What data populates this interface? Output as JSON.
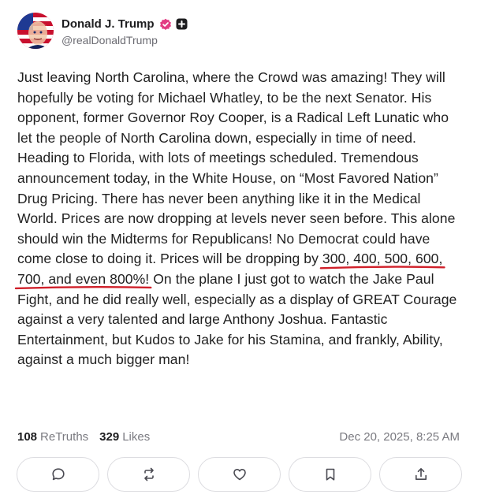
{
  "post": {
    "author": {
      "display_name": "Donald J. Trump",
      "handle": "@realDonaldTrump",
      "verified": true
    },
    "text_before": "Just leaving North Carolina, where the Crowd was amazing! They will hopefully be voting for Michael Whatley, to be the next Senator. His opponent, former Governor Roy Cooper, is a Radical Left Lunatic who let the people of North Carolina down, especially in time of need. Heading to Florida, with lots of meetings scheduled. Tremendous announcement today, in the White House, on “Most Favored Nation” Drug Pricing. There has never been anything like it in the Medical World. Prices are now dropping at levels never seen before. This alone should win the Midterms for Republicans! No Democrat could have come close to doing it. Prices will be dropping by ",
    "text_highlight": "300, 400, 500, 600, 700, and even 800%!",
    "text_after": " On the plane I just got to watch the Jake Paul Fight, and he did really well, especially as a display of GREAT Courage against a very talented and large Anthony Joshua. Fantastic Entertainment, but Kudos to Jake for his Stamina, and frankly, Ability, against a much bigger man!",
    "highlight_color": "#d0202a"
  },
  "stats": {
    "retruths_count": "108",
    "retruths_label": "ReTruths",
    "likes_count": "329",
    "likes_label": "Likes",
    "timestamp": "Dec 20, 2025, 8:25 AM"
  },
  "actions": [
    {
      "name": "reply",
      "icon": "comment-icon"
    },
    {
      "name": "retruth",
      "icon": "repost-icon"
    },
    {
      "name": "like",
      "icon": "heart-icon"
    },
    {
      "name": "bookmark",
      "icon": "bookmark-icon"
    },
    {
      "name": "share",
      "icon": "share-icon"
    }
  ],
  "colors": {
    "verified_badge": "#e23b82",
    "text": "#1f1f1f",
    "muted": "#7a7a80"
  }
}
